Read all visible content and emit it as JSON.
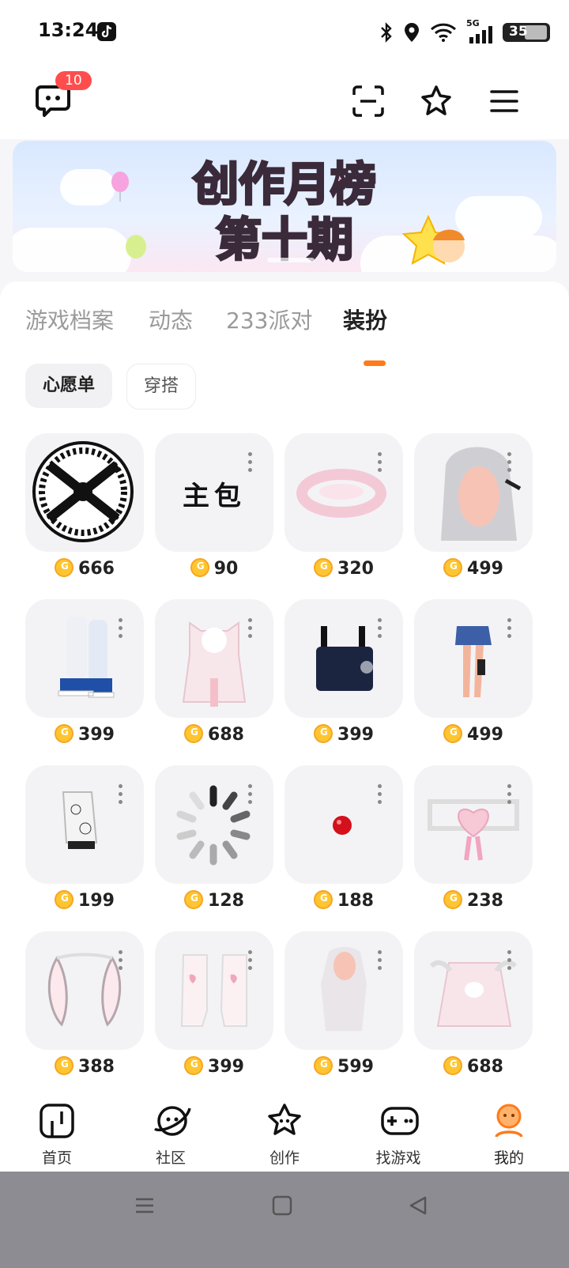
{
  "status_bar": {
    "time": "13:24",
    "battery": "35",
    "network": "5G"
  },
  "topbar": {
    "message_badge": "10"
  },
  "banner": {
    "line1": "创作月榜",
    "line2": "第十期"
  },
  "tabs": [
    {
      "label": "游戏档案"
    },
    {
      "label": "动态"
    },
    {
      "label": "233派对"
    },
    {
      "label": "装扮"
    }
  ],
  "filters": {
    "selected": "心愿单",
    "other": "穿搭"
  },
  "items": [
    {
      "name": "circle-pattern",
      "price": "666"
    },
    {
      "name": "main-bag",
      "text": "主包",
      "price": "90"
    },
    {
      "name": "pink-halo",
      "price": "320"
    },
    {
      "name": "silver-hair",
      "price": "499"
    },
    {
      "name": "sock-boots",
      "price": "399"
    },
    {
      "name": "pink-hoodie",
      "price": "688"
    },
    {
      "name": "backpack",
      "price": "399"
    },
    {
      "name": "skirt-legs",
      "price": "499"
    },
    {
      "name": "doodle-sleeve",
      "price": "199"
    },
    {
      "name": "loading",
      "price": "128"
    },
    {
      "name": "red-nose",
      "price": "188"
    },
    {
      "name": "heart-mask",
      "price": "238"
    },
    {
      "name": "bunny-ears",
      "price": "388"
    },
    {
      "name": "heart-boots",
      "price": "399"
    },
    {
      "name": "long-hair",
      "price": "599"
    },
    {
      "name": "winged-jacket",
      "price": "688"
    }
  ],
  "bottom_nav": [
    {
      "label": "首页",
      "icon": "home-icon"
    },
    {
      "label": "社区",
      "icon": "planet-icon"
    },
    {
      "label": "创作",
      "icon": "star-icon"
    },
    {
      "label": "找游戏",
      "icon": "gamepad-icon"
    },
    {
      "label": "我的",
      "icon": "profile-icon",
      "active": true
    }
  ],
  "colors": {
    "accent": "#ff7a1a",
    "badge": "#ff4d4d",
    "coin": "#ffc531"
  }
}
